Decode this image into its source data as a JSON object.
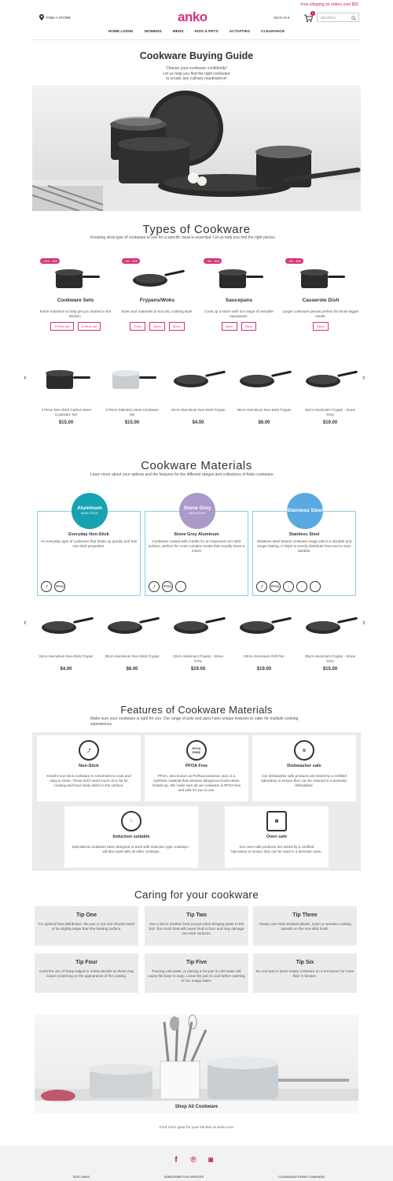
{
  "header": {
    "promo": "Free shipping on orders over $20",
    "find_store": "FIND A STORE",
    "logo": "anko",
    "sign_in": "SIGN IN",
    "cart_count": "0",
    "search_placeholder": "SEARCH"
  },
  "nav": [
    "HOME LIVING",
    "WOMENS",
    "MENS",
    "KIDS & PETS",
    "ACTIVITIES",
    "CLEARANCE"
  ],
  "guide": {
    "title": "Cookware Buying Guide",
    "intro": [
      "Choose your cookware confidently!",
      "Let us help you find the right cookware",
      "to create any culinary masterpiece!"
    ]
  },
  "types": {
    "title": "Types of Cookware",
    "intro": "Knowing what type of cookware to use for a specific meal is essential. Let us help you find the right pieces.",
    "items": [
      {
        "price": "• $15 - $15",
        "title": "Cookware Sets",
        "desc": "Entire solutions to help get you started in the kitchen.",
        "chips": [
          "3 Piece set",
          "5 Piece set"
        ]
      },
      {
        "price": "• $4 - $19",
        "title": "Frypans/Woks",
        "desc": "Sizes and materials to suit any cooking style.",
        "chips": [
          "24cm",
          "28cm",
          "32cm"
        ]
      },
      {
        "price": "• $5 - $15",
        "title": "Saucepans",
        "desc": "Cook up a storm with our range of versatile saucepans.",
        "chips": [
          "16cm",
          "20cm"
        ]
      },
      {
        "price": "• $6 - $25",
        "title": "Casserole Dish",
        "desc": "Larger cookware pieces perfect for those bigger meals.",
        "chips": [
          "24cm"
        ]
      }
    ]
  },
  "carousel1": [
    {
      "name": "3 Piece Non-Stick Carbon Steel Cookware Set",
      "price": "$15.00"
    },
    {
      "name": "3 Piece Stainless Steel Cookware Set",
      "price": "$15.00"
    },
    {
      "name": "24cm Aluminium Non-Stick Frypan",
      "price": "$4.00"
    },
    {
      "name": "28cm Aluminium Non-Stick Frypan",
      "price": "$6.00"
    },
    {
      "name": "32cm Aluminium Frypan - Stone Grey",
      "price": "$19.00"
    }
  ],
  "materials": {
    "title": "Cookware Materials",
    "intro": "Learn more about your options and the features for the different ranges and collections of Anko cookware.",
    "items": [
      {
        "circle": "Aluminum",
        "circle_sub": "NON-STICK",
        "color": "#17a2b2",
        "title": "Everyday Non-Stick",
        "desc": "An everyday type of cookware that heats up quickly and has non-stick properties.",
        "icons": [
          "non-stick",
          "PFOA FREE"
        ]
      },
      {
        "circle": "Stone Grey",
        "circle_sub": "NON-STICK",
        "color": "#a99ac9",
        "title": "Stone Grey Aluminum",
        "desc": "Cookware coated with marble for an improved non-stick surface, perfect for more complex meals that usually leave a mess!",
        "icons": [
          "non-stick",
          "PFOA FREE",
          "induction"
        ]
      },
      {
        "circle": "Stainless Steel",
        "circle_sub": "",
        "color": "#5aa9e0",
        "title": "Stainless Steel",
        "desc": "Stainless steel based cookware range which is durable and longer lasting. It helps to evenly distribute heat and is oven suitable.",
        "icons": [
          "non-stick",
          "PFOA FREE",
          "dishwasher",
          "induction",
          "oven"
        ]
      }
    ]
  },
  "carousel2": [
    {
      "name": "24cm Aluminium Non-Stick Frypan",
      "price": "$4.00"
    },
    {
      "name": "28cm Aluminium Non-Stick Frypan",
      "price": "$6.00"
    },
    {
      "name": "32cm Aluminium Frypan - Stone Grey",
      "price": "$19.00"
    },
    {
      "name": "33cm Aluminium Grill Pan",
      "price": "$19.00"
    },
    {
      "name": "35cm Aluminium Frypan - Stone Grey",
      "price": "$15.00"
    }
  ],
  "features": {
    "title": "Features of Cookware Materials",
    "intro": "Make sure your cookware is right for you. Our range of pots and pans have unique features to cater for multiple cooking experiences.",
    "items": [
      {
        "title": "Non-Stick",
        "desc": "Kmart's non-stick cookware is convenient to cook and easy to clean. These don't need much oil or fat for cooking and food rarely sticks to the surface."
      },
      {
        "title": "PFOA Free",
        "desc": "PFOA, also known as Perfluorooctanoic acid, is a synthetic material that releases dangerous toxins when heated up. We make sure all our cookware is PFOA free and safe for you to use."
      },
      {
        "title": "Dishwasher safe",
        "desc": "Our dishwasher safe products are tested by a certified laboratory to ensure they can be cleaned in a domestic dishwasher."
      },
      {
        "title": "Induction suitable",
        "desc": "Specialized cookware base designed to work with Induction type cooktops – will also work with all other cooktops."
      },
      {
        "title": "Oven safe",
        "desc": "Our oven safe products are tested by a certified laboratory to ensure they can be used in a domestic oven."
      }
    ]
  },
  "caring": {
    "title": "Caring for your cookware",
    "tips": [
      {
        "title": "Tip One",
        "desc": "For optimal heat distribution, the pan or pot size should match or be slightly larger than the heating surface."
      },
      {
        "title": "Tip Two",
        "desc": "Use a low to medium heat except when bringing water to the boil. Too much heat will cause food to burn and may damage non-stick surfaces."
      },
      {
        "title": "Tip Three",
        "desc": "Always use heat resistant plastic, nylon or wooden cooking utensils on the non-stick finish."
      },
      {
        "title": "Tip Four",
        "desc": "Avoid the use of sharp-edged or metal utensils as these may cause scratching on the appearance of the coating."
      },
      {
        "title": "Tip Five",
        "desc": "Pouring cold water, or placing a hot pan in cold water will cause the base to warp. Leave the pan to cool before washing in hot, soapy water."
      },
      {
        "title": "Tip Six",
        "desc": "Do not heat or leave empty cookware on a hot burner for more than 3 minutes."
      }
    ]
  },
  "shop_all": "Shop All Cookware",
  "more_gear": "Find more gear for your kitchen at anko.com",
  "footer": {
    "cols": [
      "SITE LINKS",
      "SUBSCRIBE FOR UPDATES",
      "CLEARANCE EVENT CAMPAIGN"
    ]
  }
}
